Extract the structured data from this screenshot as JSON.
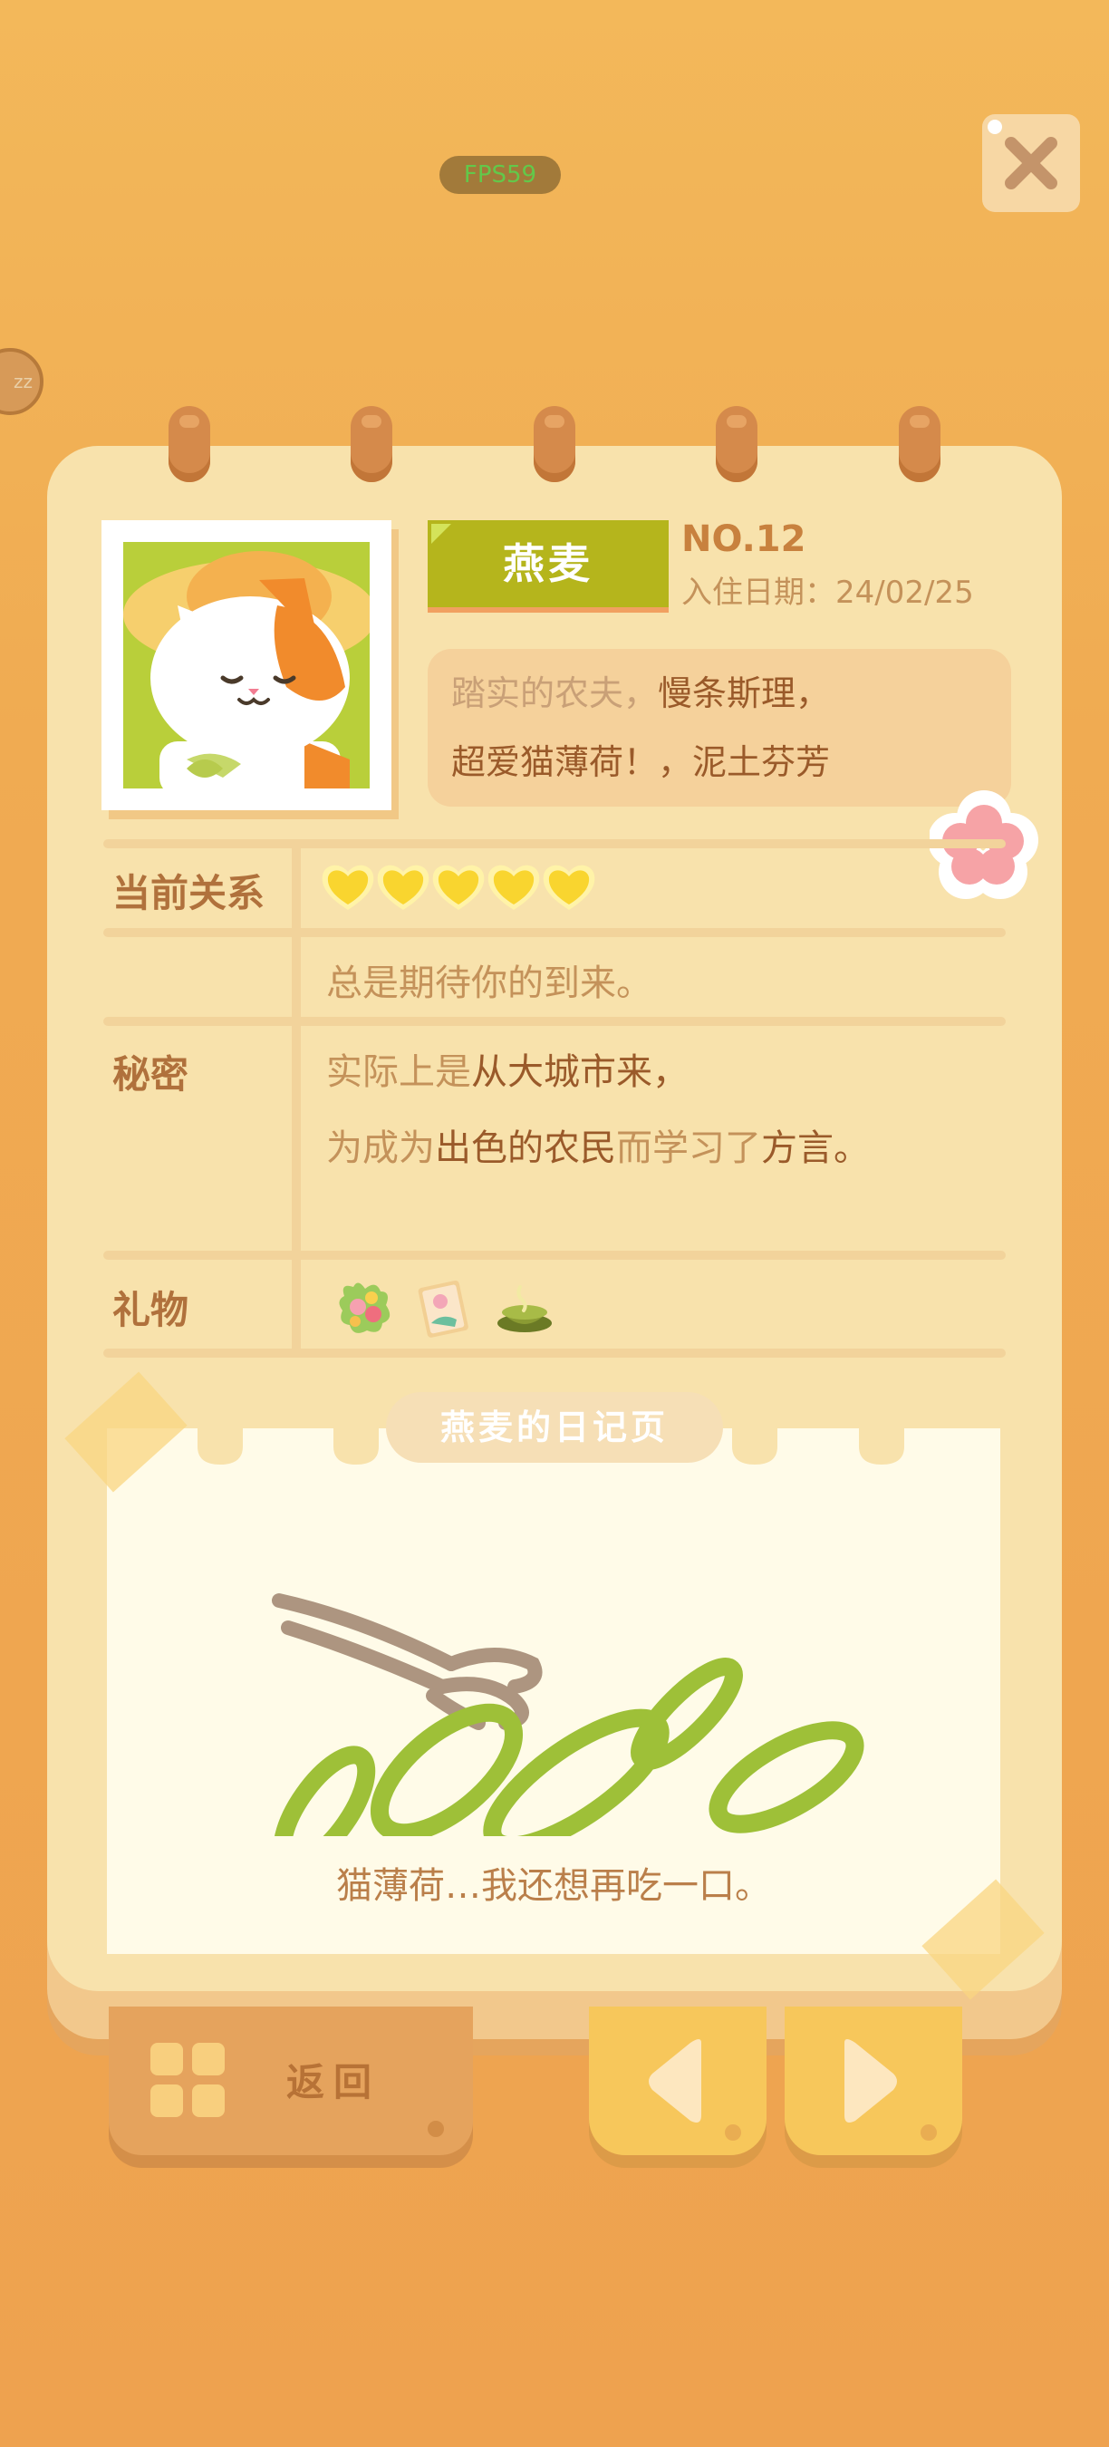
{
  "hud": {
    "fps": "FPS59",
    "sleep_badge": "zz"
  },
  "profile": {
    "name": "燕麦",
    "number": "NO.12",
    "checkin_date": "入住日期：24/02/25",
    "desc_line1_a": "踏实的农夫，",
    "desc_line1_b": "慢条斯理，",
    "desc_line2": "超爱猫薄荷！，泥土芬芳"
  },
  "table": {
    "relation_label": "当前关系",
    "hearts": 5,
    "relation_text": "总是期待你的到来。",
    "secret_label": "秘密",
    "secret_line1_a": "实际上是",
    "secret_line1_b": "从大城市来，",
    "secret_line2_a": "为成为",
    "secret_line2_b": "出色的农民",
    "secret_line2_c": "而学习了",
    "secret_line2_d": "方言。",
    "gift_label": "礼物",
    "gifts": [
      "flower-bouquet-icon",
      "picture-card-icon",
      "matcha-bowl-icon"
    ]
  },
  "diary": {
    "tab_title": "燕麦的日记页",
    "caption": "猫薄荷…我还想再吃一口。"
  },
  "buttons": {
    "back_label": "返回"
  },
  "colors": {
    "accent_green": "#b5b51c",
    "heart": "#f9d52f",
    "background": "#f0ab52"
  }
}
